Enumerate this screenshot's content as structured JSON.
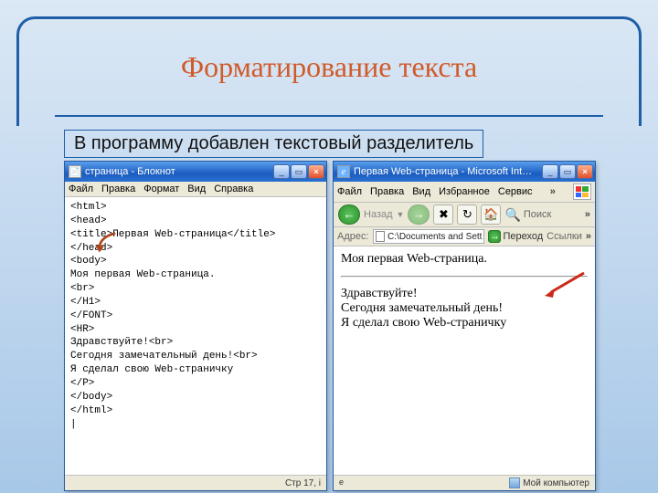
{
  "slide": {
    "title": "Форматирование текста",
    "subtitle": "В программу добавлен текстовый разделитель"
  },
  "notepad": {
    "window_title": "страница - Блокнот",
    "menu": [
      "Файл",
      "Правка",
      "Формат",
      "Вид",
      "Справка"
    ],
    "code": "<html>\n<head>\n<title>Первая Web-страница</title>\n</head>\n<body>\nМоя первая Web-страница.\n<br>\n</H1>\n</FONT>\n<HR>\nЗдравствуйте!<br>\nСегодня замечательный день!<br>\nЯ сделал свою Web-страничку\n</P>\n</body>\n</html>\n|",
    "status": "Стр 17, i"
  },
  "ie": {
    "window_title": "Первая Web-страница - Microsoft Int…",
    "menu": [
      "Файл",
      "Правка",
      "Вид",
      "Избранное",
      "Сервис"
    ],
    "back_label": "Назад",
    "search_label": "Поиск",
    "address_label": "Адрес:",
    "address_value": "C:\\Documents and Sett",
    "go_label": "Переход",
    "links_label": "Ссылки",
    "page": {
      "heading": "Моя первая Web-страница.",
      "line1": "Здравствуйте!",
      "line2": "Сегодня замечательный день!",
      "line3": "Я сделал свою Web-страничку"
    },
    "status_zone": "Мой компьютер"
  }
}
